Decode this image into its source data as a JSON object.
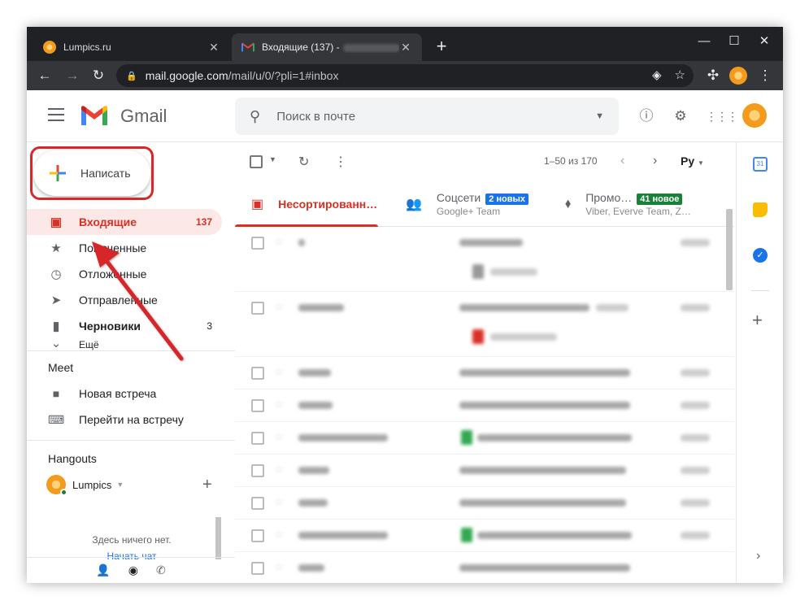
{
  "browser": {
    "tabs": [
      {
        "title": "Lumpics.ru",
        "favicon_color": "#f29b1d",
        "active": false
      },
      {
        "title": "Входящие (137) -",
        "favicon_color": "#ea4335",
        "active": true
      }
    ],
    "url_host": "mail.google.com",
    "url_path": "/mail/u/0/?pli=1#inbox"
  },
  "gmail": {
    "app_name": "Gmail",
    "search_placeholder": "Поиск в почте",
    "compose_label": "Написать",
    "nav": [
      {
        "label": "Входящие",
        "count": "137",
        "icon": "inbox-icon",
        "active": true,
        "bold": true
      },
      {
        "label": "Помеченные",
        "count": "",
        "icon": "star-icon",
        "active": false,
        "bold": false
      },
      {
        "label": "Отложенные",
        "count": "",
        "icon": "clock-icon",
        "active": false,
        "bold": false
      },
      {
        "label": "Отправленные",
        "count": "",
        "icon": "send-icon",
        "active": false,
        "bold": false
      },
      {
        "label": "Черновики",
        "count": "3",
        "icon": "draft-icon",
        "active": false,
        "bold": true
      }
    ],
    "more_label": "Ещё",
    "meet": {
      "title": "Meet",
      "new_meeting": "Новая встреча",
      "join_meeting": "Перейти на встречу"
    },
    "hangouts": {
      "title": "Hangouts",
      "user": "Lumpics",
      "empty_text": "Здесь ничего нет.",
      "start_chat": "Начать чат"
    },
    "list": {
      "range": "1–50 из 170",
      "lang_label": "Ру"
    },
    "category_tabs": [
      {
        "name": "Несортированн…",
        "badge": "",
        "sub": "",
        "active": true
      },
      {
        "name": "Соцсети",
        "badge": "2 новых",
        "badge_color": "#1a73e8",
        "sub": "Google+ Team",
        "active": false
      },
      {
        "name": "Промо…",
        "badge": "41 новое",
        "badge_color": "#188038",
        "sub": "Viber, Everve Team, Z…",
        "active": false
      }
    ],
    "accent_color": "#d93025"
  }
}
